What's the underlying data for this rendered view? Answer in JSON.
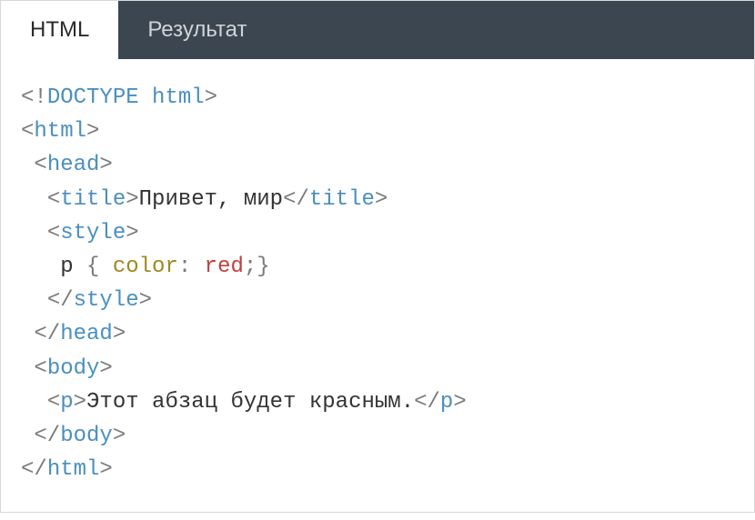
{
  "tabs": {
    "html": "HTML",
    "result": "Результат"
  },
  "code": {
    "doctype_open": "<!",
    "doctype_kw": "DOCTYPE",
    "doctype_sp": " ",
    "doctype_html": "html",
    "doctype_close": ">",
    "html_open_l": "<",
    "html_open_t": "html",
    "html_open_r": ">",
    "head_open_l": "<",
    "head_open_t": "head",
    "head_open_r": ">",
    "title_open_l": "<",
    "title_open_t": "title",
    "title_open_r": ">",
    "title_text": "Привет, мир",
    "title_close_l": "</",
    "title_close_t": "title",
    "title_close_r": ">",
    "style_open_l": "<",
    "style_open_t": "style",
    "style_open_r": ">",
    "css_selector": "p",
    "css_brace_l": " { ",
    "css_prop": "color",
    "css_colon": ": ",
    "css_value": "red",
    "css_semi": ";",
    "css_brace_r": "}",
    "style_close_l": "</",
    "style_close_t": "style",
    "style_close_r": ">",
    "head_close_l": "</",
    "head_close_t": "head",
    "head_close_r": ">",
    "body_open_l": "<",
    "body_open_t": "body",
    "body_open_r": ">",
    "p_open_l": "<",
    "p_open_t": "p",
    "p_open_r": ">",
    "p_text": "Этот абзац будет красным.",
    "p_close_l": "</",
    "p_close_t": "p",
    "p_close_r": ">",
    "body_close_l": "</",
    "body_close_t": "body",
    "body_close_r": ">",
    "html_close_l": "</",
    "html_close_t": "html",
    "html_close_r": ">"
  }
}
